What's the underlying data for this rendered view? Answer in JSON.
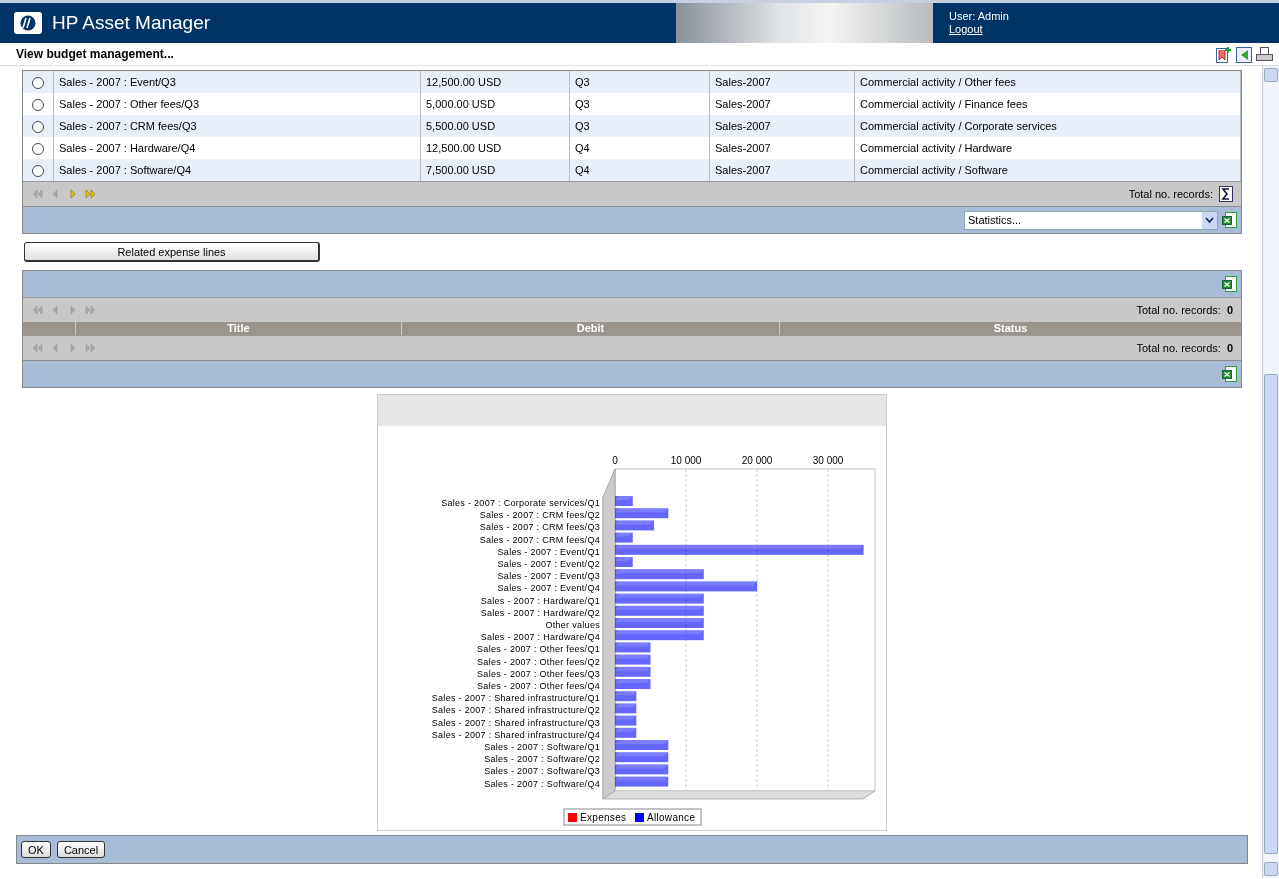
{
  "header": {
    "title": "HP Asset Manager",
    "user": "User: Admin",
    "logout": "Logout"
  },
  "page_title": "View budget management...",
  "budget_table": {
    "rows": [
      {
        "selected": false,
        "name": "Sales - 2007 : Event/Q3",
        "amount": "12,500.00 USD",
        "period": "Q3",
        "budget": "Sales-2007",
        "category": "Commercial activity / Other fees"
      },
      {
        "selected": false,
        "name": "Sales - 2007 : Other fees/Q3",
        "amount": "5,000.00 USD",
        "period": "Q3",
        "budget": "Sales-2007",
        "category": "Commercial activity / Finance fees"
      },
      {
        "selected": false,
        "name": "Sales - 2007 : CRM fees/Q3",
        "amount": "5,500.00 USD",
        "period": "Q3",
        "budget": "Sales-2007",
        "category": "Commercial activity / Corporate services"
      },
      {
        "selected": false,
        "name": "Sales - 2007 : Hardware/Q4",
        "amount": "12,500.00 USD",
        "period": "Q4",
        "budget": "Sales-2007",
        "category": "Commercial activity / Hardware"
      },
      {
        "selected": false,
        "name": "Sales - 2007 : Software/Q4",
        "amount": "7,500.00 USD",
        "period": "Q4",
        "budget": "Sales-2007",
        "category": "Commercial activity / Software"
      }
    ],
    "pager": {
      "buttons": [
        {
          "kind": "first",
          "disabled": true
        },
        {
          "kind": "prev",
          "disabled": true
        },
        {
          "kind": "next",
          "disabled": false
        },
        {
          "kind": "last",
          "disabled": false
        }
      ],
      "total_label": "Total no. records:"
    },
    "statistics": {
      "value": "Statistics..."
    }
  },
  "related_button": "Related expense lines",
  "expense_table": {
    "pager_top": {
      "buttons": [
        {
          "kind": "first",
          "disabled": true
        },
        {
          "kind": "prev",
          "disabled": true
        },
        {
          "kind": "next",
          "disabled": true
        },
        {
          "kind": "last",
          "disabled": true
        }
      ],
      "total_label": "Total no. records:",
      "total": "0"
    },
    "columns": [
      "Title",
      "Debit",
      "Status"
    ],
    "pager_bottom": {
      "buttons": [
        {
          "kind": "first",
          "disabled": true
        },
        {
          "kind": "prev",
          "disabled": true
        },
        {
          "kind": "next",
          "disabled": true
        },
        {
          "kind": "last",
          "disabled": true
        }
      ],
      "total_label": "Total no. records:",
      "total": "0"
    }
  },
  "chart": {
    "chart_data": {
      "type": "bar",
      "orientation": "horizontal",
      "grid": true,
      "xlim": [
        0,
        36600
      ],
      "xticks": [
        0,
        {
          "value": 10000,
          "label": "10 000"
        },
        {
          "value": 20000,
          "label": "20 000"
        },
        {
          "value": 30000,
          "label": "30 000"
        }
      ],
      "categories": [
        "Sales - 2007 : Corporate services/Q1",
        "Sales - 2007 : CRM fees/Q2",
        "Sales - 2007 : CRM fees/Q3",
        "Sales - 2007 : CRM fees/Q4",
        "Sales - 2007 : Event/Q1",
        "Sales - 2007 : Event/Q2",
        "Sales - 2007 : Event/Q3",
        "Sales - 2007 : Event/Q4",
        "Sales - 2007 : Hardware/Q1",
        "Sales - 2007 : Hardware/Q2",
        "Other values",
        "Sales - 2007 : Hardware/Q4",
        "Sales - 2007 : Other fees/Q1",
        "Sales - 2007 : Other fees/Q2",
        "Sales - 2007 : Other fees/Q3",
        "Sales - 2007 : Other fees/Q4",
        "Sales - 2007 : Shared infrastructure/Q1",
        "Sales - 2007 : Shared infrastructure/Q2",
        "Sales - 2007 : Shared infrastructure/Q3",
        "Sales - 2007 : Shared infrastructure/Q4",
        "Sales - 2007 : Software/Q1",
        "Sales - 2007 : Software/Q2",
        "Sales - 2007 : Software/Q3",
        "Sales - 2007 : Software/Q4"
      ],
      "series": [
        {
          "name": "Allowance",
          "color": "#0000ff",
          "values": [
            2500,
            7500,
            5500,
            2500,
            35000,
            2500,
            12500,
            20000,
            12500,
            12500,
            12500,
            12500,
            5000,
            5000,
            5000,
            5000,
            3000,
            3000,
            3000,
            3000,
            7500,
            7500,
            7500,
            7500
          ]
        }
      ]
    },
    "legend_extra_items": [
      {
        "label": "Expenses",
        "color": "#ff0000"
      }
    ]
  },
  "buttons": [
    "OK",
    "Cancel"
  ]
}
